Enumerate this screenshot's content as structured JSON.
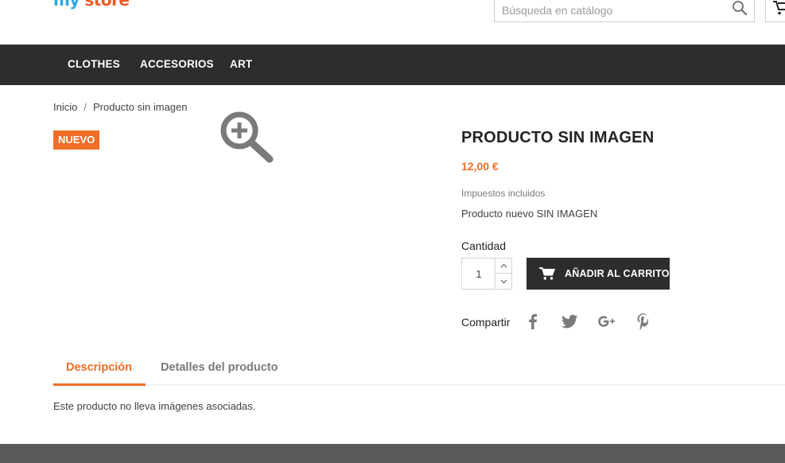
{
  "header": {
    "logo_part1": "my",
    "logo_part2": "store",
    "search_placeholder": "Búsqueda en catálogo",
    "search_icon": "search-icon",
    "cart_icon": "shopping-cart-icon"
  },
  "nav": {
    "items": [
      {
        "label": "CLOTHES"
      },
      {
        "label": "ACCESORIOS"
      },
      {
        "label": "ART"
      }
    ]
  },
  "breadcrumb": {
    "home": "Inicio",
    "separator": "/",
    "current": "Producto sin imagen"
  },
  "product": {
    "badge": "NUEVO",
    "zoom_icon": "zoom-in-icon",
    "title": "PRODUCTO SIN IMAGEN",
    "price": "12,00 €",
    "tax_note": "Impuestos incluidos",
    "short_description": "Producto nuevo SIN IMAGEN",
    "quantity_label": "Cantidad",
    "quantity_value": "1",
    "add_to_cart_label": "AÑADIR AL CARRITO",
    "share_label": "Compartir",
    "share_icons": [
      "facebook-icon",
      "twitter-icon",
      "google-plus-icon",
      "pinterest-icon"
    ]
  },
  "tabs": {
    "items": [
      {
        "label": "Descripción",
        "active": true
      },
      {
        "label": "Detalles del producto",
        "active": false
      }
    ],
    "content": "Este producto no lleva imágenes asociadas."
  },
  "colors": {
    "accent": "#f26d25",
    "nav_bg": "#2d2d2d",
    "footer_bg": "#5a5a5a"
  }
}
